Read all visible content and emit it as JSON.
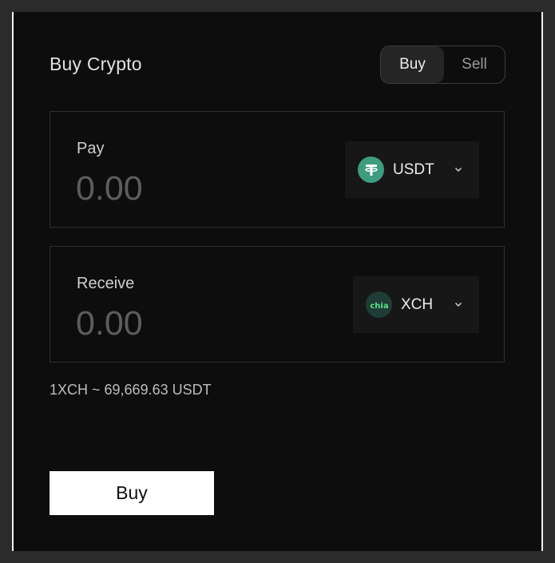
{
  "title": "Buy Crypto",
  "mode_toggle": {
    "buy_label": "Buy",
    "sell_label": "Sell",
    "selected": "Buy"
  },
  "pay": {
    "label": "Pay",
    "placeholder": "0.00",
    "token": {
      "symbol": "USDT",
      "icon": "tether-icon",
      "color": "#3e9d7e"
    }
  },
  "receive": {
    "label": "Receive",
    "placeholder": "0.00",
    "token": {
      "symbol": "XCH",
      "icon": "chia-icon",
      "icon_text": "chia",
      "color": "#1f3c36"
    }
  },
  "rate_text": "1XCH ~ 69,669.63 USDT",
  "submit_label": "Buy"
}
